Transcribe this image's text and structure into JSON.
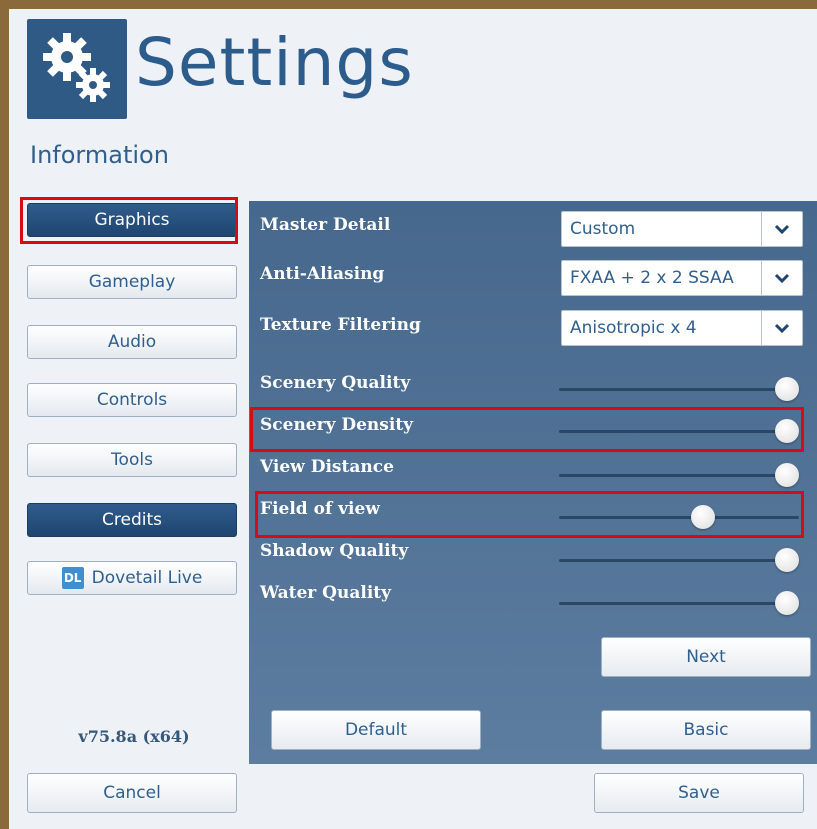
{
  "header": {
    "title": "Settings",
    "subtitle": "Information"
  },
  "sidebar": {
    "items": [
      {
        "label": "Graphics",
        "active": true
      },
      {
        "label": "Gameplay",
        "active": false
      },
      {
        "label": "Audio",
        "active": false
      },
      {
        "label": "Controls",
        "active": false
      },
      {
        "label": "Tools",
        "active": false
      },
      {
        "label": "Credits",
        "active": true
      },
      {
        "label": "Dovetail Live",
        "active": false,
        "icon": "dovetail-live-icon"
      }
    ],
    "version": "v75.8a (x64)"
  },
  "options": {
    "dropdowns": [
      {
        "label": "Master Detail",
        "value": "Custom"
      },
      {
        "label": "Anti-Aliasing",
        "value": "FXAA + 2 x 2 SSAA"
      },
      {
        "label": "Texture Filtering",
        "value": "Anisotropic x 4"
      }
    ],
    "sliders": [
      {
        "label": "Scenery Quality",
        "value": 1.0
      },
      {
        "label": "Scenery Density",
        "value": 1.0
      },
      {
        "label": "View Distance",
        "value": 1.0
      },
      {
        "label": "Field of view",
        "value": 0.63
      },
      {
        "label": "Shadow Quality",
        "value": 1.0
      },
      {
        "label": "Water Quality",
        "value": 1.0
      }
    ]
  },
  "buttons": {
    "next": "Next",
    "default": "Default",
    "basic": "Basic",
    "cancel": "Cancel",
    "save": "Save"
  },
  "colors": {
    "accent": "#2c5c8c",
    "panel": "#4f7196",
    "highlight": "#d80a14"
  }
}
